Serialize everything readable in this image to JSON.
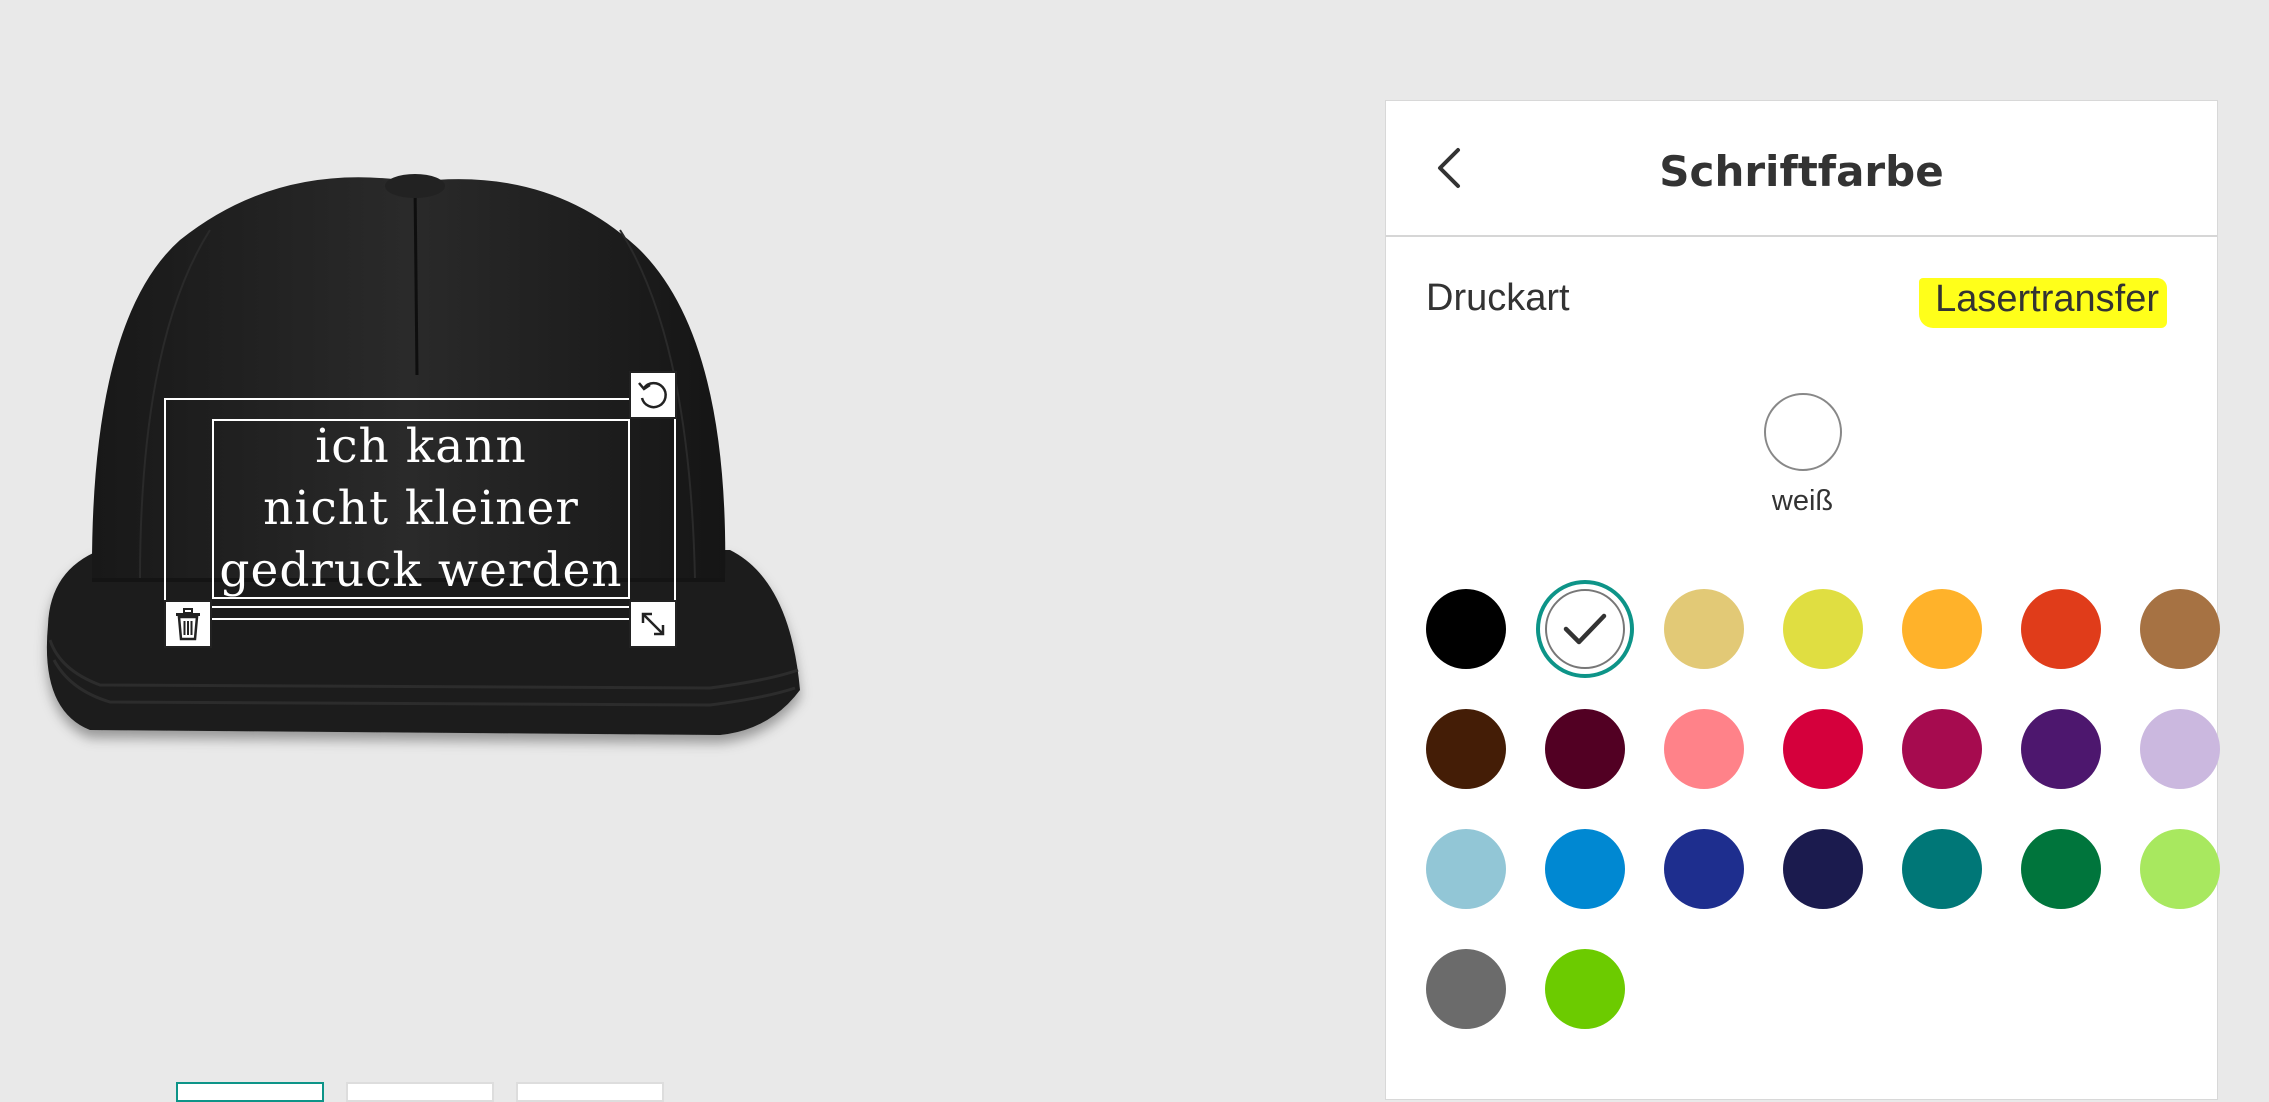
{
  "design": {
    "lines": [
      "ich kann",
      "nicht kleiner",
      "gedruck werden"
    ]
  },
  "panel": {
    "title": "Schriftfarbe",
    "print_type_label": "Druckart",
    "print_type_value": "Lasertransfer",
    "selected_color_name": "weiß"
  },
  "colors": {
    "accent": "#0d9488",
    "highlight": "#ffff1a",
    "cap": "#1d1d1d",
    "swatches": [
      {
        "hex": "#000000",
        "selected": false
      },
      {
        "hex": "#ffffff",
        "selected": true
      },
      {
        "hex": "#e2c976",
        "selected": false
      },
      {
        "hex": "#e0de41",
        "selected": false
      },
      {
        "hex": "#ffb22a",
        "selected": false
      },
      {
        "hex": "#e03c1a",
        "selected": false
      },
      {
        "hex": "#a67243",
        "selected": false
      },
      {
        "hex": "#441d06",
        "selected": false
      },
      {
        "hex": "#520023",
        "selected": false
      },
      {
        "hex": "#ff8289",
        "selected": false
      },
      {
        "hex": "#d5003c",
        "selected": false
      },
      {
        "hex": "#a60b4f",
        "selected": false
      },
      {
        "hex": "#4d176e",
        "selected": false
      },
      {
        "hex": "#cbb8df",
        "selected": false
      },
      {
        "hex": "#92c6d6",
        "selected": false
      },
      {
        "hex": "#0088d2",
        "selected": false
      },
      {
        "hex": "#1e2e8e",
        "selected": false
      },
      {
        "hex": "#1b1b4e",
        "selected": false
      },
      {
        "hex": "#007777",
        "selected": false
      },
      {
        "hex": "#00753c",
        "selected": false
      },
      {
        "hex": "#a8e85f",
        "selected": false
      },
      {
        "hex": "#6b6b6b",
        "selected": false
      },
      {
        "hex": "#6ccb00",
        "selected": false
      }
    ]
  },
  "icons": {
    "back": "chevron-left-icon",
    "rotate": "rotate-icon",
    "delete": "trash-icon",
    "resize": "resize-icon",
    "check": "checkmark-icon"
  }
}
